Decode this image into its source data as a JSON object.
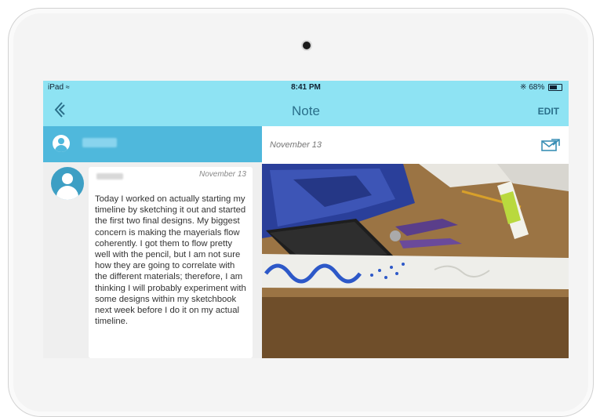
{
  "status_bar": {
    "device": "iPad",
    "time": "8:41 PM",
    "battery": "68%"
  },
  "nav": {
    "title": "Note",
    "edit_label": "EDIT"
  },
  "note": {
    "date": "November 13",
    "text": "Today I worked on actually starting my timeline by sketching it out and started the first two final designs. My biggest concern is making the mayerials flow coherently. I got them to flow pretty well with the pencil, but I am not sure how they are going to correlate with the different materials; therefore, I am thinking I will probably experiment with some designs within my sketchbook next week before I do it on my actual timeline."
  },
  "detail": {
    "date": "November 13"
  },
  "colors": {
    "nav_bg": "#8ee3f3",
    "accent": "#4fb8dc",
    "nav_text": "#2a6f8a"
  },
  "icons": [
    "wifi-icon",
    "bluetooth-icon",
    "battery-icon",
    "back-chevron-icon",
    "user-avatar-icon",
    "share-mail-icon"
  ]
}
